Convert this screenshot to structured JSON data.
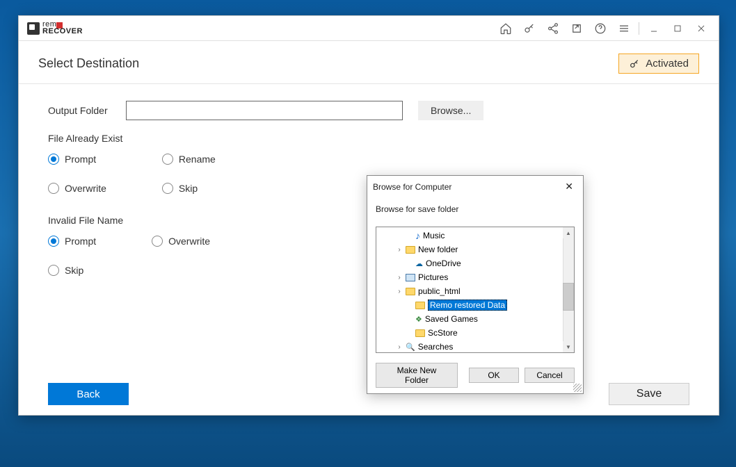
{
  "titlebar": {
    "logo_top": "rem",
    "logo_bottom": "RECOVER"
  },
  "header": {
    "title": "Select Destination",
    "activated": "Activated"
  },
  "form": {
    "output_label": "Output Folder",
    "output_value": "",
    "browse": "Browse...",
    "exist_label": "File Already Exist",
    "invalid_label": "Invalid File Name",
    "radios_exist": {
      "prompt": "Prompt",
      "rename": "Rename",
      "overwrite": "Overwrite",
      "skip": "Skip"
    },
    "radios_invalid": {
      "prompt": "Prompt",
      "overwrite": "Overwrite",
      "skip": "Skip"
    }
  },
  "buttons": {
    "back": "Back",
    "save": "Save"
  },
  "dialog": {
    "title": "Browse for Computer",
    "subtitle": "Browse for save folder",
    "items": {
      "music": "Music",
      "newfolder": "New folder",
      "onedrive": "OneDrive",
      "pictures": "Pictures",
      "public_html": "public_html",
      "remo": "Remo restored Data",
      "saved_games": "Saved Games",
      "scstore": "ScStore",
      "searches": "Searches"
    },
    "make_new": "Make New Folder",
    "ok": "OK",
    "cancel": "Cancel"
  }
}
